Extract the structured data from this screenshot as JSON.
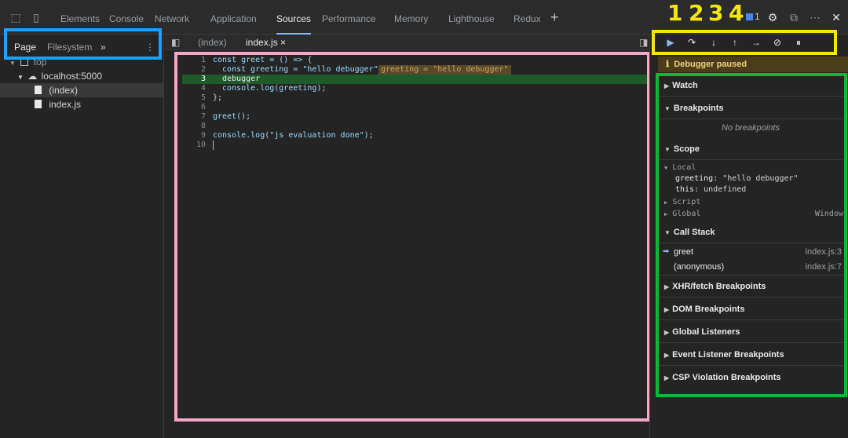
{
  "topbar": {
    "tabs": [
      "Elements",
      "Console",
      "Network",
      "Application",
      "Sources",
      "Performance",
      "Memory",
      "Lighthouse",
      "Redux"
    ],
    "active_tab": "Sources",
    "add_tab": "+",
    "badge_count": "1",
    "more": "⋯",
    "close": "✕"
  },
  "annotations": {
    "n1": "1",
    "n2": "2",
    "n3": "3",
    "n4": "4"
  },
  "navigator": {
    "tabs": [
      "Page",
      "Filesystem",
      "»"
    ],
    "more": "⋮",
    "tree": [
      "top",
      "localhost:5000",
      "(index)",
      "index.js"
    ]
  },
  "editor": {
    "tabs": [
      "(index)",
      "index.js",
      "×"
    ],
    "lines": [
      "const greet = () => {",
      "  const greeting = \"hello debugger\";",
      "  debugger",
      "  console.log(greeting);",
      "};",
      "",
      "greet();",
      "",
      "console.log(\"js evaluation done\");",
      ""
    ],
    "line_numbers": [
      "1",
      "2",
      "3",
      "4",
      "5",
      "6",
      "7",
      "8",
      "9",
      "10"
    ],
    "inline_value": "greeting = \"hello debugger\"",
    "highlight_line": 3
  },
  "debugger": {
    "paused_text": "Debugger paused",
    "sections": {
      "watch": "Watch",
      "breakpoints": "Breakpoints",
      "no_breakpoints": "No breakpoints",
      "scope": "Scope",
      "call_stack": "Call Stack",
      "xhr": "XHR/fetch Breakpoints",
      "dom": "DOM Breakpoints",
      "global_listeners": "Global Listeners",
      "event_listener": "Event Listener Breakpoints",
      "csp": "CSP Violation Breakpoints"
    },
    "scope": {
      "local": "Local",
      "greeting_key": "greeting:",
      "greeting_val": "\"hello debugger\"",
      "this_key": "this:",
      "this_val": "undefined",
      "script": "Script",
      "global": "Global",
      "global_val": "Window"
    },
    "call_stack": [
      {
        "fn": "greet",
        "loc": "index.js:3"
      },
      {
        "fn": "(anonymous)",
        "loc": "index.js:7"
      }
    ]
  },
  "colors": {
    "yellow": "#f5e50a",
    "blue": "#1ea0ff",
    "pink": "#f5a7c7",
    "green": "#0fb83a"
  }
}
